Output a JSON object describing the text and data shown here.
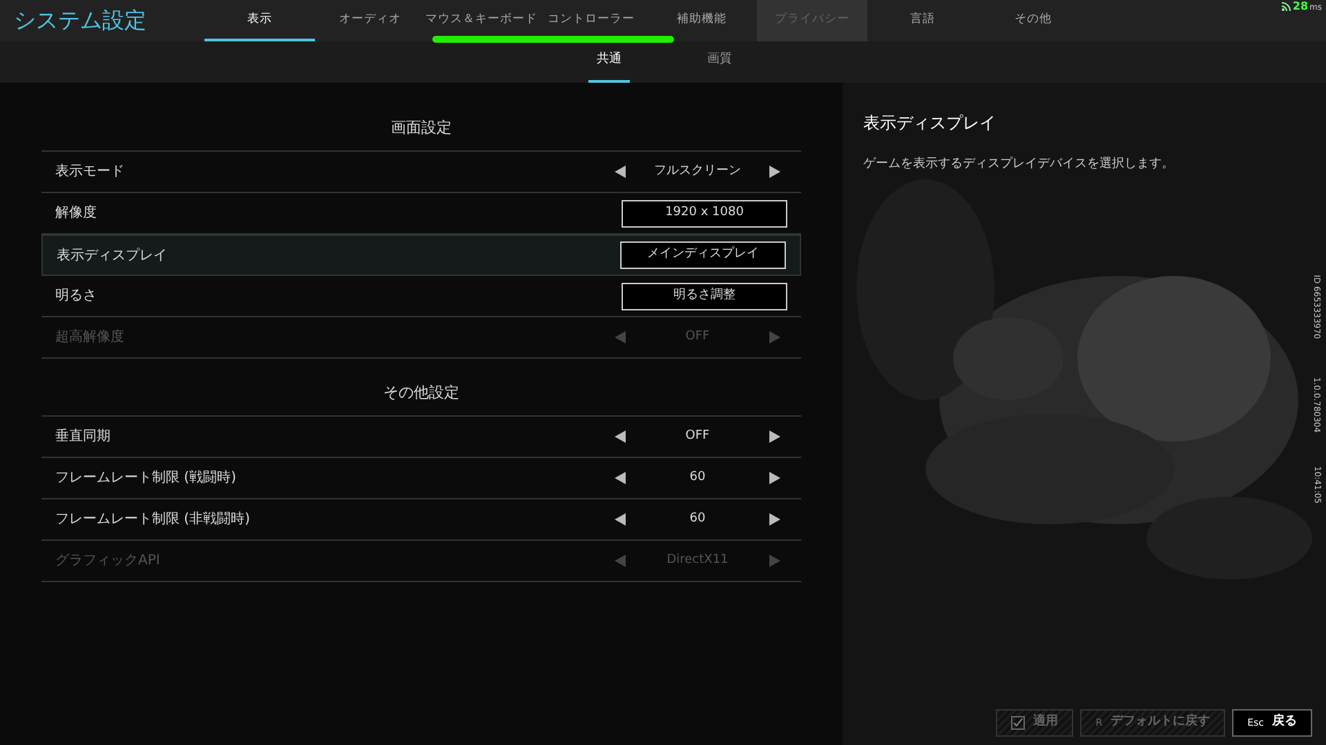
{
  "title": "システム設定",
  "tabs": [
    {
      "label": "表示",
      "selected": true,
      "disabled": false
    },
    {
      "label": "オーディオ",
      "selected": false,
      "disabled": false
    },
    {
      "label": "マウス＆キーボード",
      "selected": false,
      "disabled": false
    },
    {
      "label": "コントローラー",
      "selected": false,
      "disabled": false
    },
    {
      "label": "補助機能",
      "selected": false,
      "disabled": false
    },
    {
      "label": "プライバシー",
      "selected": false,
      "disabled": true
    },
    {
      "label": "言語",
      "selected": false,
      "disabled": false
    },
    {
      "label": "その他",
      "selected": false,
      "disabled": false
    }
  ],
  "ping": "28",
  "ping_unit": "ms",
  "subtabs": [
    {
      "label": "共通",
      "selected": true
    },
    {
      "label": "画質",
      "selected": false
    }
  ],
  "sections": [
    {
      "title": "画面設定",
      "rows": [
        {
          "label": "表示モード",
          "kind": "select",
          "value": "フルスクリーン",
          "disabled": false,
          "selected": false
        },
        {
          "label": "解像度",
          "kind": "button",
          "value": "1920 x 1080",
          "disabled": false,
          "selected": false
        },
        {
          "label": "表示ディスプレイ",
          "kind": "button",
          "value": "メインディスプレイ",
          "disabled": false,
          "selected": true
        },
        {
          "label": "明るさ",
          "kind": "button",
          "value": "明るさ調整",
          "disabled": false,
          "selected": false
        },
        {
          "label": "超高解像度",
          "kind": "select",
          "value": "OFF",
          "disabled": true,
          "selected": false
        }
      ]
    },
    {
      "title": "その他設定",
      "rows": [
        {
          "label": "垂直同期",
          "kind": "select",
          "value": "OFF",
          "disabled": false,
          "selected": false
        },
        {
          "label": "フレームレート制限 (戦闘時)",
          "kind": "select",
          "value": "60",
          "disabled": false,
          "selected": false
        },
        {
          "label": "フレームレート制限 (非戦闘時)",
          "kind": "select",
          "value": "60",
          "disabled": false,
          "selected": false
        },
        {
          "label": "グラフィックAPI",
          "kind": "select",
          "value": "DirectX11",
          "disabled": true,
          "selected": false
        }
      ]
    }
  ],
  "detail": {
    "title": "表示ディスプレイ",
    "description": "ゲームを表示するディスプレイデバイスを選択します。"
  },
  "side_info": [
    "ID 6653333970",
    "1.0.0.780304",
    "10:41:05"
  ],
  "footer": [
    {
      "label": "適用",
      "disabled": true,
      "kind": "check"
    },
    {
      "key": "R",
      "label": "デフォルトに戻す",
      "disabled": true,
      "kind": "key"
    },
    {
      "key": "Esc",
      "label": "戻る",
      "disabled": false,
      "kind": "key"
    }
  ]
}
